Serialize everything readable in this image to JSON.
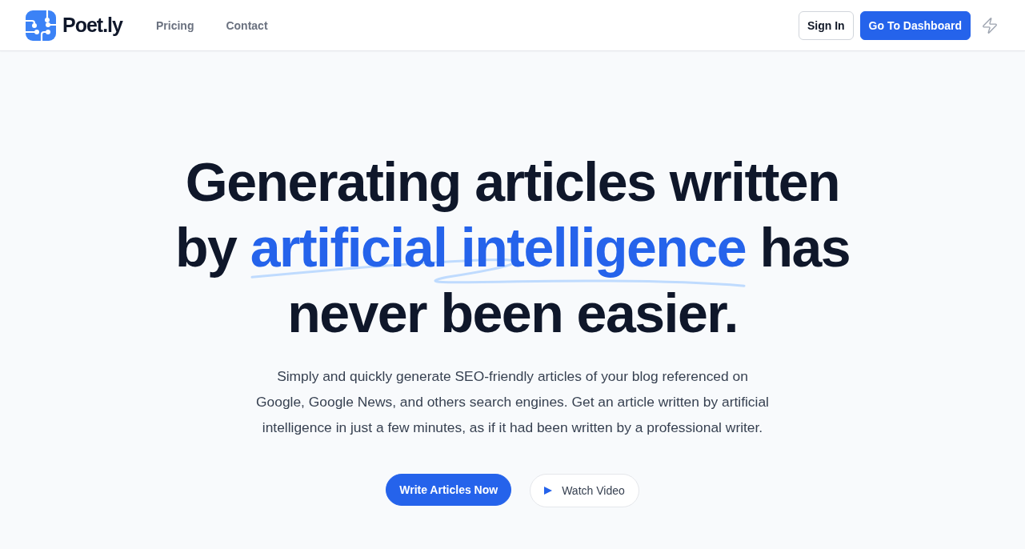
{
  "header": {
    "logo": {
      "text": "Poet.ly"
    },
    "nav": [
      "Pricing",
      "Contact"
    ],
    "actions": [
      {
        "label": "Sign In",
        "kind": "outline"
      },
      {
        "label": "Go To Dashboard",
        "kind": "primary"
      }
    ]
  },
  "hero": {
    "title_before": "Generating articles written by",
    "title_highlight": "artificial intelligence",
    "title_after": "has never been easier.",
    "description": "Simply and quickly generate SEO-friendly articles of your blog referenced on Google, Google News, and others search engines. Get an article written by artificial intelligence in just a few minutes, as if it had been written by a professional writer.",
    "buttons": [
      {
        "label": "Write Articles Now",
        "kind": "primary"
      },
      {
        "label": "Watch Video",
        "kind": "video"
      }
    ]
  }
}
